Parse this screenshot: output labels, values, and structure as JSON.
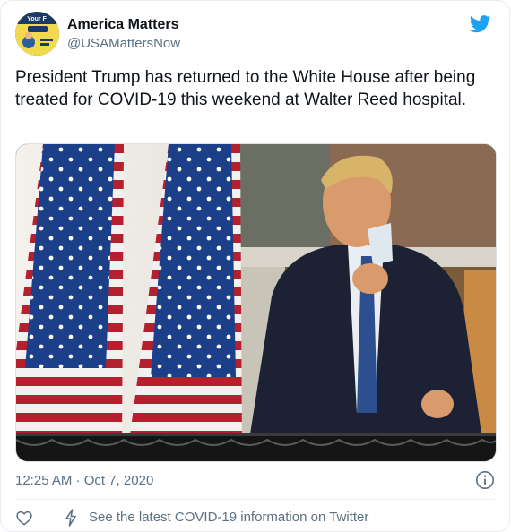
{
  "tweet": {
    "author_name": "America Matters",
    "author_handle": "@USAMattersNow",
    "text": "President Trump has returned to the White House after being treated for COVID-19 this weekend at Walter Reed hospital.",
    "timestamp_time": "12:25 AM",
    "timestamp_separator": " · ",
    "timestamp_date": "Oct 7, 2020",
    "avatar_text": "Your F",
    "media_description": "photo"
  },
  "footer": {
    "covid_link": "See the latest COVID-19 information on Twitter"
  },
  "icons": {
    "brand": "twitter-bird-icon",
    "info": "info-icon",
    "like": "heart-icon",
    "notice": "lightning-bolt-icon"
  },
  "colors": {
    "brand_blue": "#1da1f2",
    "secondary_text": "#5b7083",
    "primary_text": "#0f1419",
    "border": "#e6ecf0"
  }
}
